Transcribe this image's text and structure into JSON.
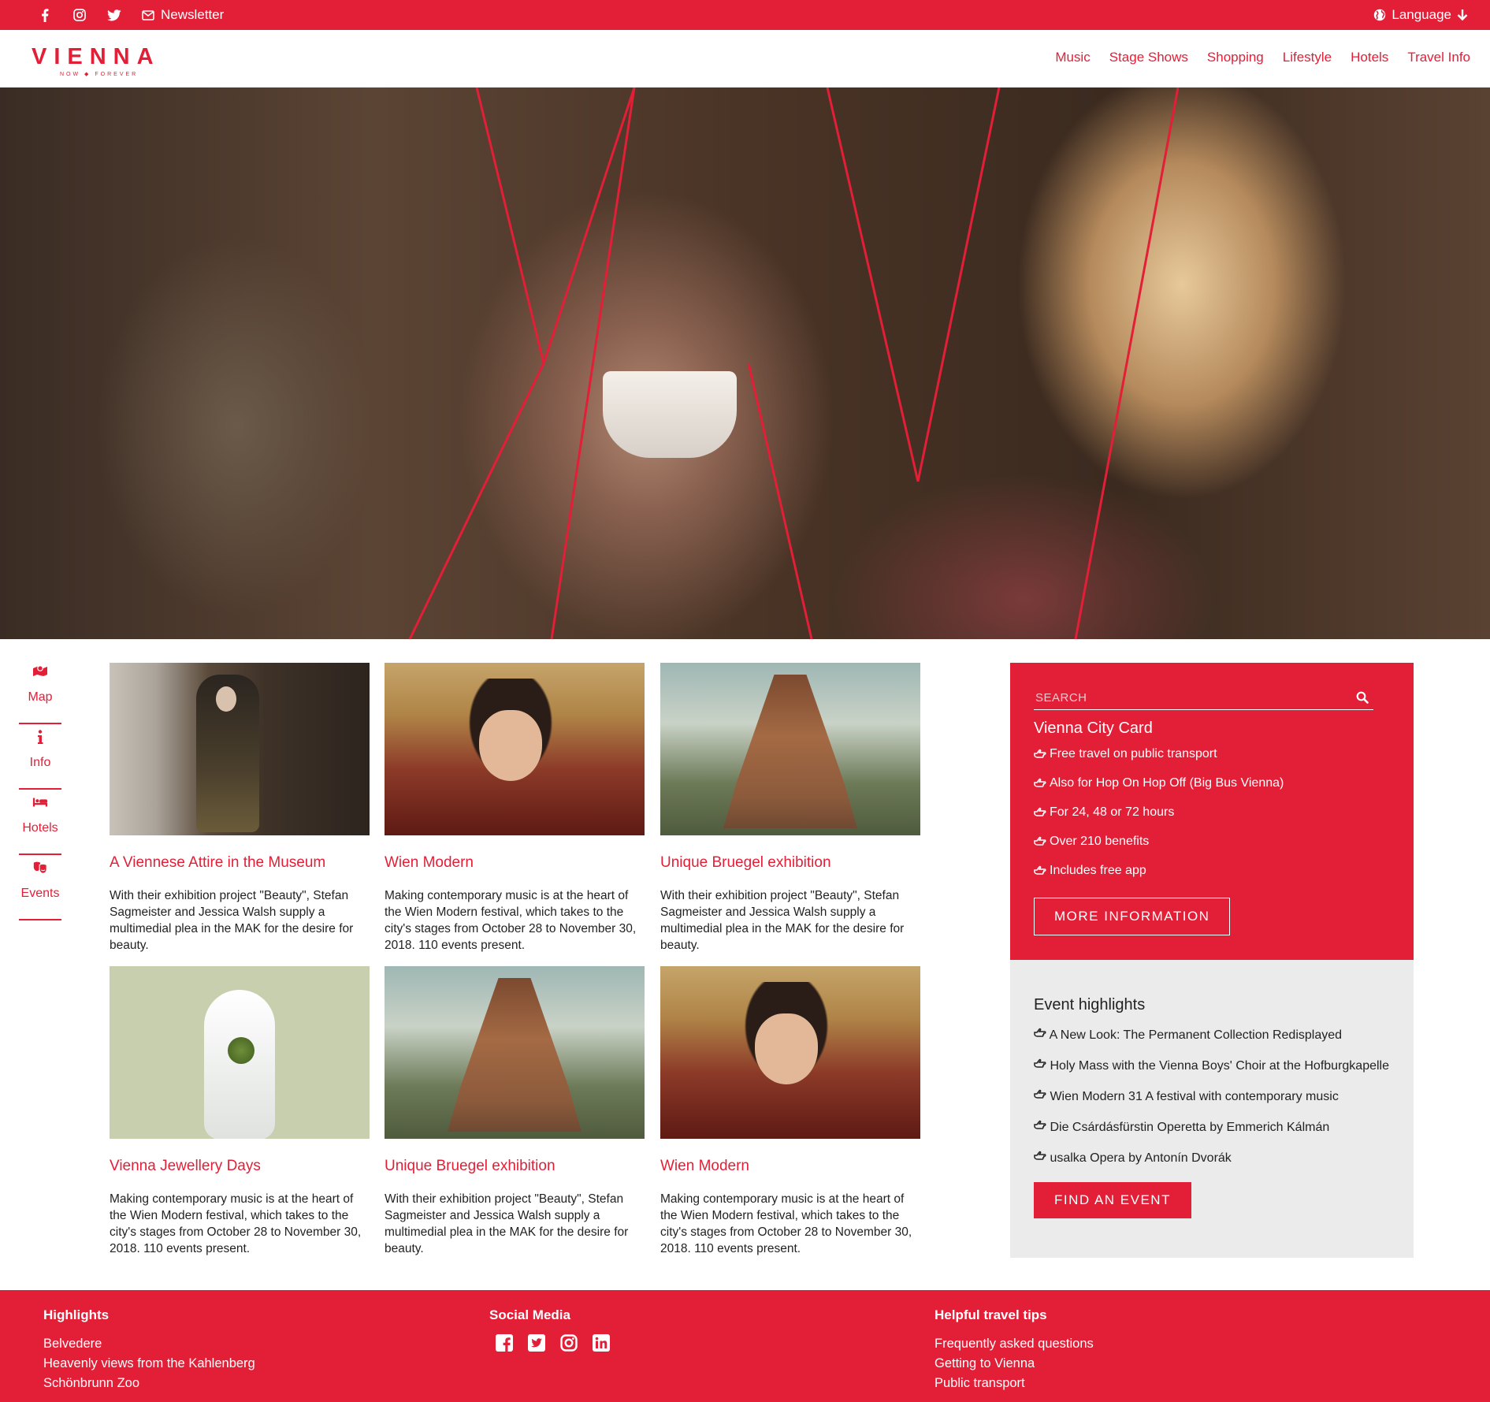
{
  "topbar": {
    "social_icons": [
      "facebook-icon",
      "instagram-icon",
      "twitter-icon"
    ],
    "newsletter": "Newsletter",
    "language": "Language"
  },
  "header": {
    "logo_word": "VIENNA",
    "logo_tag": "NOW ◆ FOREVER",
    "nav": [
      "Music",
      "Stage Shows",
      "Shopping",
      "Lifestyle",
      "Hotels",
      "Travel Info"
    ]
  },
  "sidenav": [
    {
      "label": "Map",
      "icon": "map-icon"
    },
    {
      "label": "Info",
      "icon": "info-icon"
    },
    {
      "label": "Hotels",
      "icon": "bed-icon"
    },
    {
      "label": "Events",
      "icon": "theater-masks-icon"
    }
  ],
  "cards": [
    {
      "title": "A Viennese Attire in the Museum",
      "desc": "With their exhibition project \"Beauty\", Stefan Sagmeister and Jessica Walsh supply a multimedial plea in the MAK for the desire for beauty."
    },
    {
      "title": "Wien Modern",
      "desc": "Making contemporary music is at the heart of the Wien Modern festival, which takes to the city's stages from October 28 to November 30, 2018. 110 events present."
    },
    {
      "title": "Unique Bruegel exhibition",
      "desc": "With their exhibition project \"Beauty\", Stefan Sagmeister and Jessica Walsh supply a multimedial plea in the MAK for the desire for beauty."
    },
    {
      "title": "Vienna Jewellery Days",
      "desc": "Making contemporary music is at the heart of the Wien Modern festival, which takes to the city's stages from October 28 to November 30, 2018. 110 events present."
    },
    {
      "title": "Unique Bruegel exhibition",
      "desc": "With their exhibition project \"Beauty\", Stefan Sagmeister and Jessica Walsh supply a multimedial plea in the MAK for the desire for beauty."
    },
    {
      "title": "Wien Modern",
      "desc": "Making contemporary music is at the heart of the Wien Modern festival, which takes to the city's stages from October 28 to November 30, 2018. 110 events present."
    }
  ],
  "city_card": {
    "search_placeholder": "SEARCH",
    "title": "Vienna City Card",
    "benefits": [
      "Free travel on public transport",
      "Also for Hop On Hop Off (Big Bus Vienna)",
      "For 24, 48 or 72 hours",
      "Over 210 benefits",
      "Includes free app"
    ],
    "button": "MORE INFORMATION"
  },
  "events": {
    "title": "Event highlights",
    "items": [
      "A New Look: The Permanent Collection Redisplayed",
      "Holy Mass with the Vienna Boys' Choir at the Hofburgkapelle",
      "Wien Modern 31 A festival with contemporary music",
      "Die Csárdásfürstin Operetta by Emmerich Kálmán",
      "usalka Opera by Antonín Dvorák"
    ],
    "button": "FIND AN EVENT"
  },
  "footer": {
    "highlights": {
      "title": "Highlights",
      "links": [
        "Belvedere",
        "Heavenly views from the Kahlenberg",
        "Schönbrunn Zoo"
      ]
    },
    "social": {
      "title": "Social Media",
      "icons": [
        "facebook-square-icon",
        "twitter-square-icon",
        "instagram-icon",
        "linkedin-icon"
      ]
    },
    "tips": {
      "title": "Helpful travel tips",
      "links": [
        "Frequently asked questions",
        "Getting to Vienna",
        "Public transport"
      ]
    }
  },
  "colors": {
    "brand": "#e31e37",
    "panel_grey": "#ebebeb"
  }
}
